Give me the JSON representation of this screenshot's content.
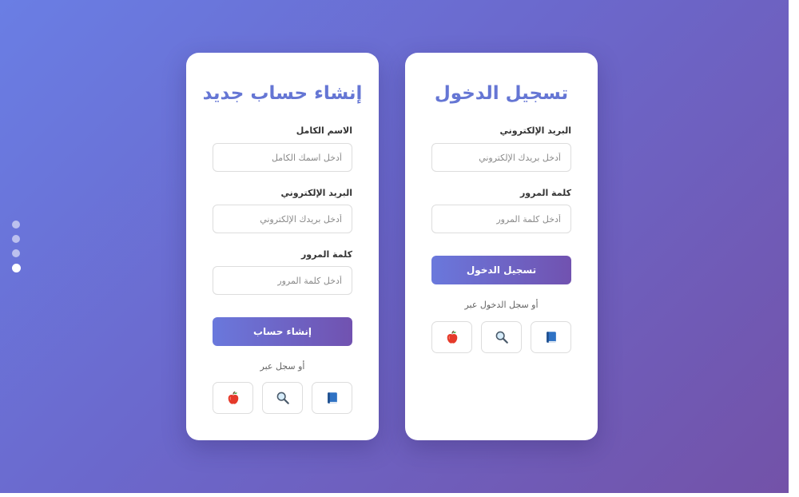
{
  "login": {
    "title": "تسجيل الدخول",
    "email_label": "البريد الإلكتروني",
    "email_placeholder": "أدخل بريدك الإلكتروني",
    "email_value": "",
    "password_label": "كلمة المرور",
    "password_placeholder": "أدخل كلمة المرور",
    "password_value": "",
    "submit_label": "تسجيل الدخول",
    "or_text": "أو سجل الدخول عبر"
  },
  "register": {
    "title": "إنشاء حساب جديد",
    "name_label": "الاسم الكامل",
    "name_placeholder": "أدخل اسمك الكامل",
    "name_value": "",
    "email_label": "البريد الإلكتروني",
    "email_placeholder": "أدخل بريدك الإلكتروني",
    "email_value": "",
    "password_label": "كلمة المرور",
    "password_placeholder": "أدخل كلمة المرور",
    "password_value": "",
    "submit_label": "إنشاء حساب",
    "or_text": "أو سجل عبر"
  },
  "social_icons": [
    "apple-icon",
    "magnifier-icon",
    "book-icon"
  ],
  "pagination": {
    "dot_count": 4,
    "active_index": 3
  },
  "colors": {
    "title": "#6576d4",
    "gradient_start": "#6a7ee4",
    "gradient_end": "#7352a8",
    "card_background": "#ffffff"
  }
}
